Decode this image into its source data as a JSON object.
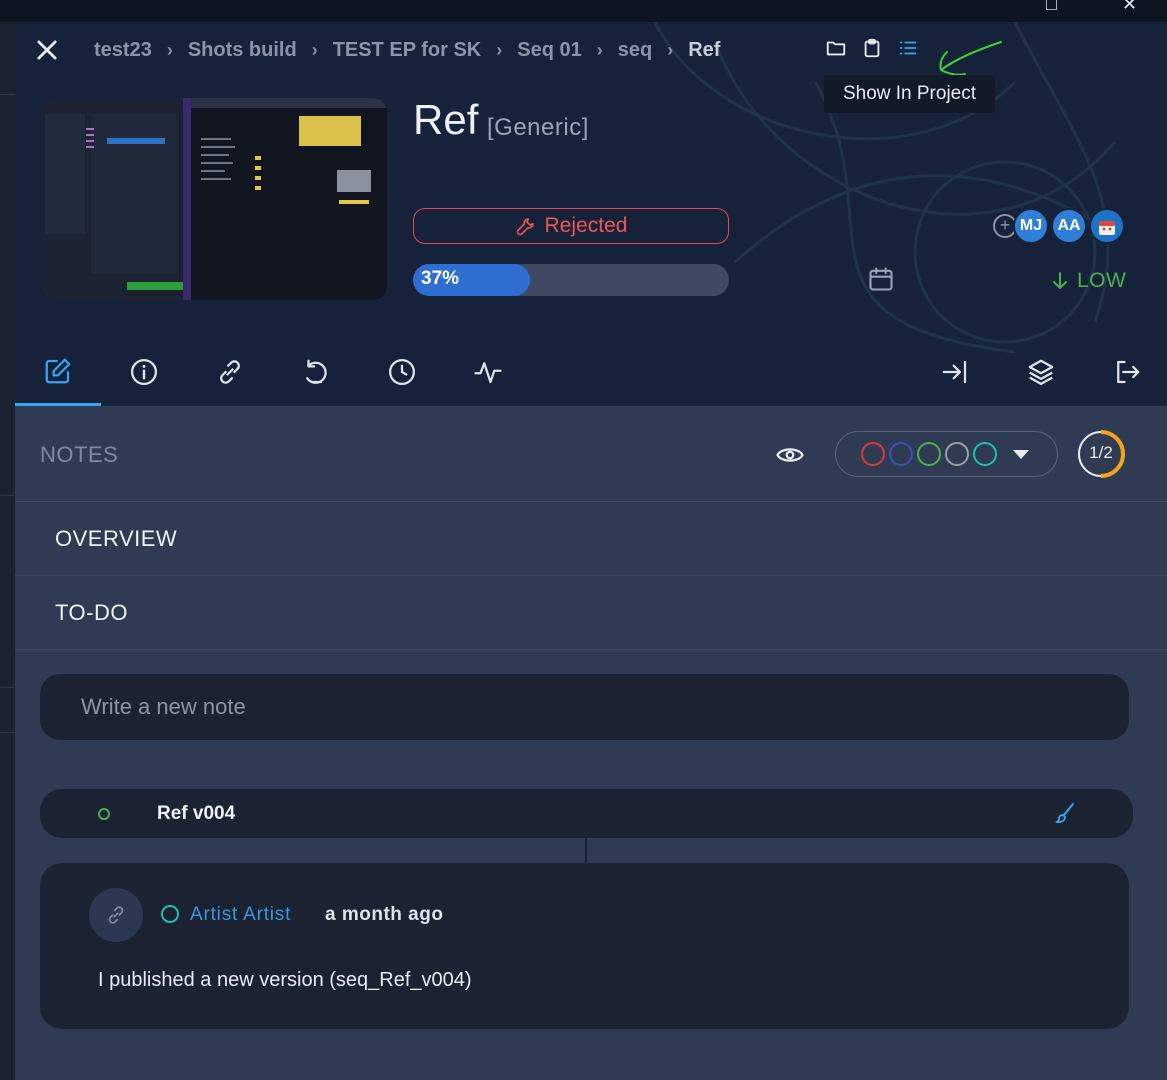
{
  "breadcrumb": {
    "items": [
      "test23",
      "Shots build",
      "TEST EP for SK",
      "Seq 01",
      "seq",
      "Ref"
    ],
    "separator": "›"
  },
  "tooltip": {
    "text": "Show In Project"
  },
  "entity": {
    "name": "Ref",
    "type": "[Generic]",
    "status": "Rejected",
    "progress": 37,
    "progress_label": "37%",
    "priority": "LOW",
    "assignees": [
      {
        "initials": "MJ",
        "color": "#2f7fd8"
      },
      {
        "initials": "AA",
        "color": "#2f7fd8"
      }
    ]
  },
  "tabs": [
    "edit-icon",
    "info-icon",
    "link-icon",
    "history-icon",
    "clock-icon",
    "activity-icon",
    "enter-icon",
    "layers-icon",
    "exit-icon"
  ],
  "notes": {
    "title": "NOTES",
    "filter_colors": [
      "#d43b3b",
      "#3f51b5",
      "#4caf50",
      "#9e9e9e",
      "#1ec0b0"
    ],
    "counter": "1/2",
    "counter_fraction": 0.5
  },
  "sections": {
    "overview": "OVERVIEW",
    "todo": "TO-DO"
  },
  "note_input": {
    "placeholder": "Write a new note"
  },
  "version": {
    "label": "Ref v004"
  },
  "comment": {
    "author": "Artist Artist",
    "time": "a month ago",
    "body": "I published a new version (seq_Ref_v004)"
  },
  "colors": {
    "accent": "#35a6ef",
    "rejected": "#ec5656",
    "priority_low": "#4caf50",
    "progress": "#2f6fd1"
  }
}
